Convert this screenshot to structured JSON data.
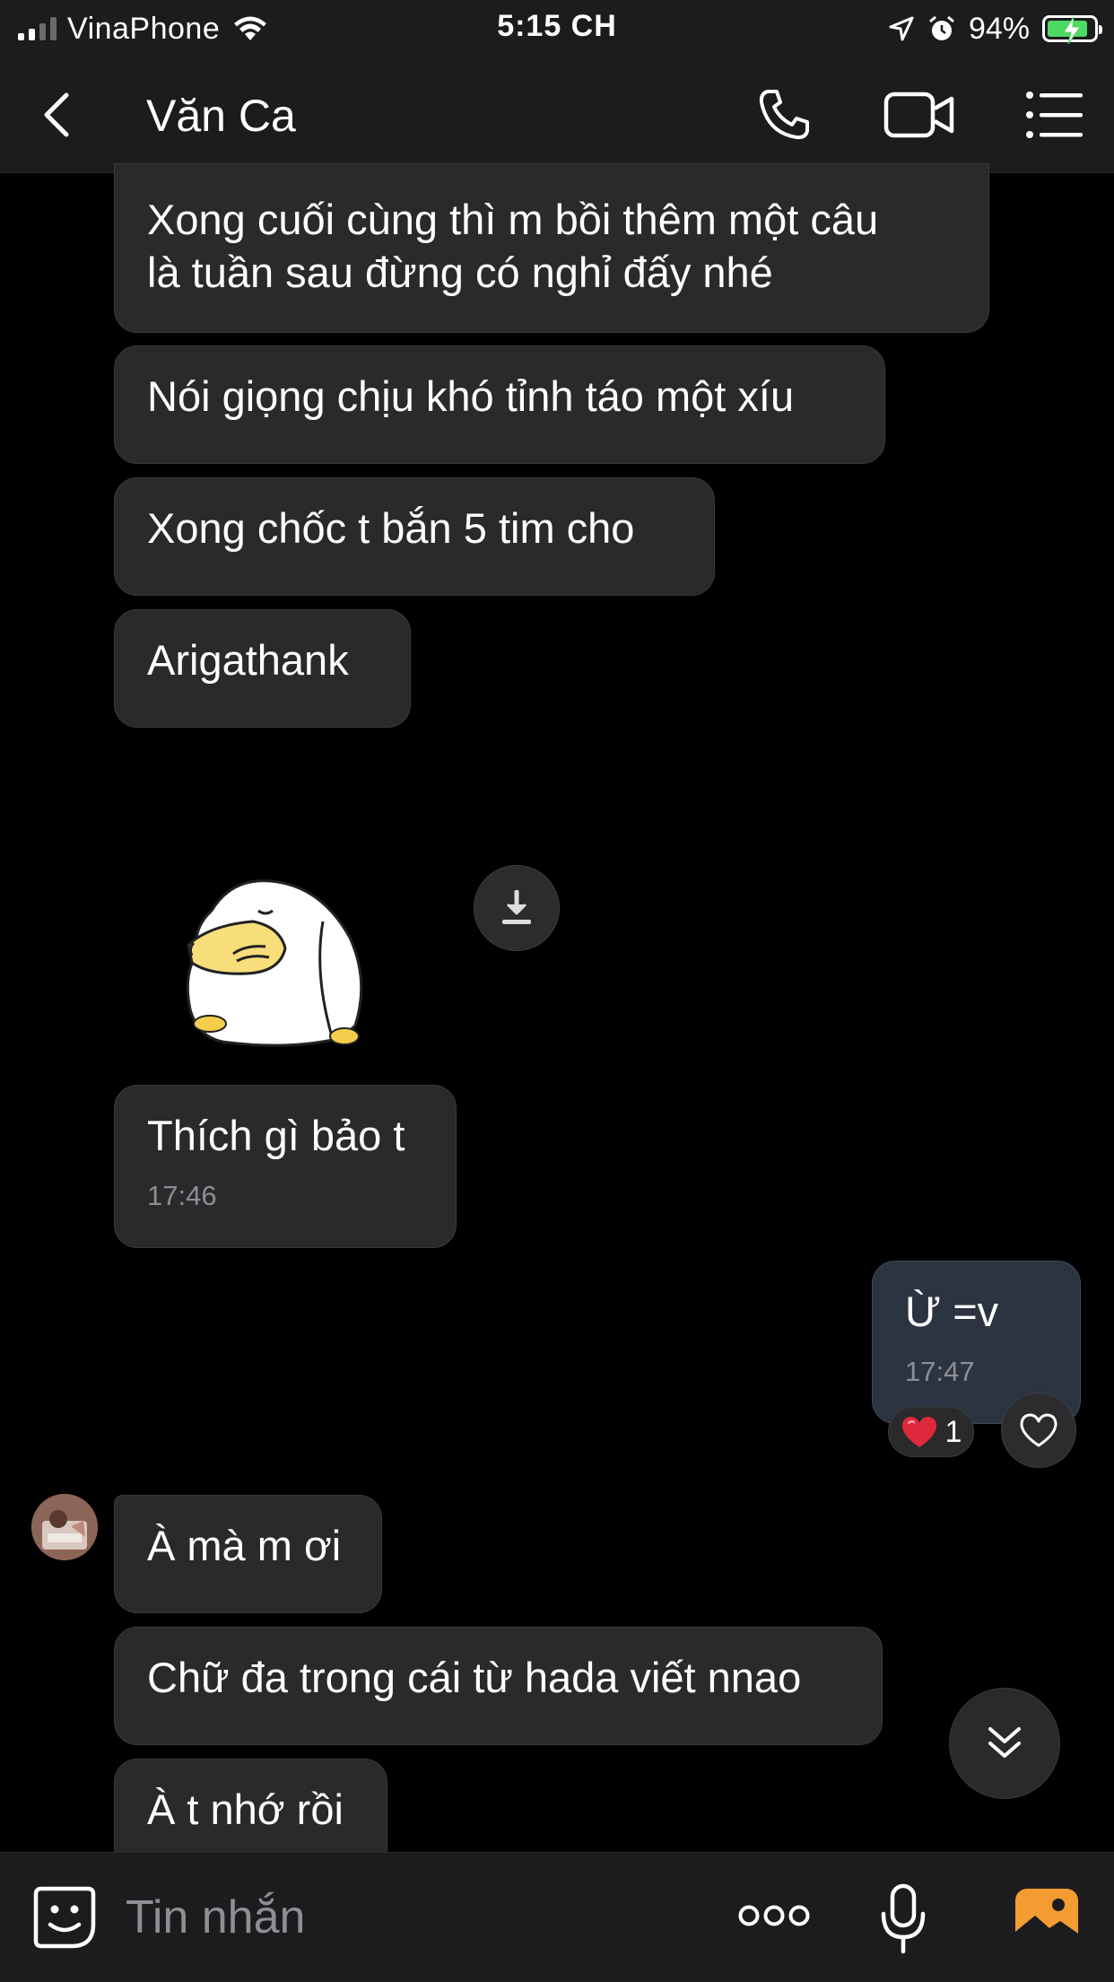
{
  "status_bar": {
    "carrier": "VinaPhone",
    "time": "5:15 CH",
    "battery_percent": "94%",
    "signal_bars": 2,
    "icons": [
      "signal-icon",
      "wifi-icon",
      "location-icon",
      "alarm-icon",
      "battery-icon"
    ]
  },
  "header": {
    "contact_name": "Văn Ca",
    "icons": [
      "back-arrow-icon",
      "phone-icon",
      "video-camera-icon",
      "list-menu-icon"
    ]
  },
  "messages": [
    {
      "direction": "in",
      "lines": [
        "Xong cuối cùng thì m bồi thêm một câu",
        "là tuần sau đừng có nghỉ đấy nhé"
      ]
    },
    {
      "direction": "in",
      "text": "Nói giọng chịu khó tỉnh táo một xíu"
    },
    {
      "direction": "in",
      "text": "Xong chốc t bắn 5 tim cho"
    },
    {
      "direction": "in",
      "text": "Arigathank"
    },
    {
      "direction": "in",
      "type": "sticker",
      "icon": "duck-sticker-icon"
    },
    {
      "direction": "in",
      "text": "Thích gì bảo t",
      "time": "17:46"
    },
    {
      "direction": "out",
      "text": "Ừ =v",
      "time": "17:47",
      "reaction": {
        "emoji": "heart",
        "count": "1"
      }
    },
    {
      "direction": "in",
      "text": "À mà m ơi"
    },
    {
      "direction": "in",
      "text": "Chữ đa trong cái từ hada viết nnao"
    },
    {
      "direction": "in",
      "text": "À t nhớ rồi"
    }
  ],
  "input": {
    "placeholder": "Tin nhắn",
    "value": ""
  },
  "colors": {
    "background": "#000000",
    "bar": "#1c1c1e",
    "bubble_in": "#2a2a2c",
    "bubble_out": "#2b3440",
    "timestamp": "#8e8e93",
    "battery": "#4cd964",
    "gallery_accent": "#f39c32",
    "heart": "#e0283c"
  }
}
